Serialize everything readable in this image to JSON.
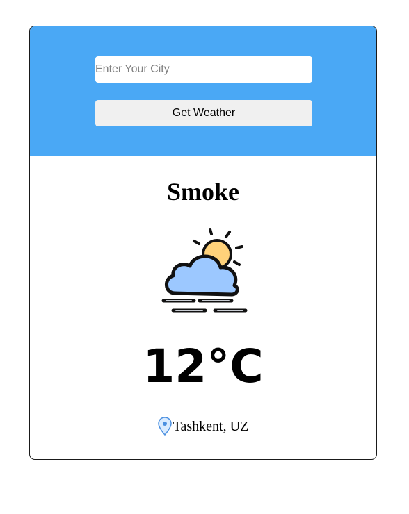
{
  "search": {
    "placeholder": "Enter Your City",
    "value": ""
  },
  "actions": {
    "get_weather_label": "Get Weather"
  },
  "weather": {
    "condition": "Smoke",
    "icon": "cloud-sun-fog-icon",
    "temperature": "12°C",
    "location": "Tashkent, UZ"
  },
  "colors": {
    "header_background": "#4aa8f5",
    "button_background": "#f0f0f0",
    "card_border": "#1a1a1a",
    "icon_cloud": "#9cc8ff",
    "icon_sun": "#ffd27a"
  }
}
